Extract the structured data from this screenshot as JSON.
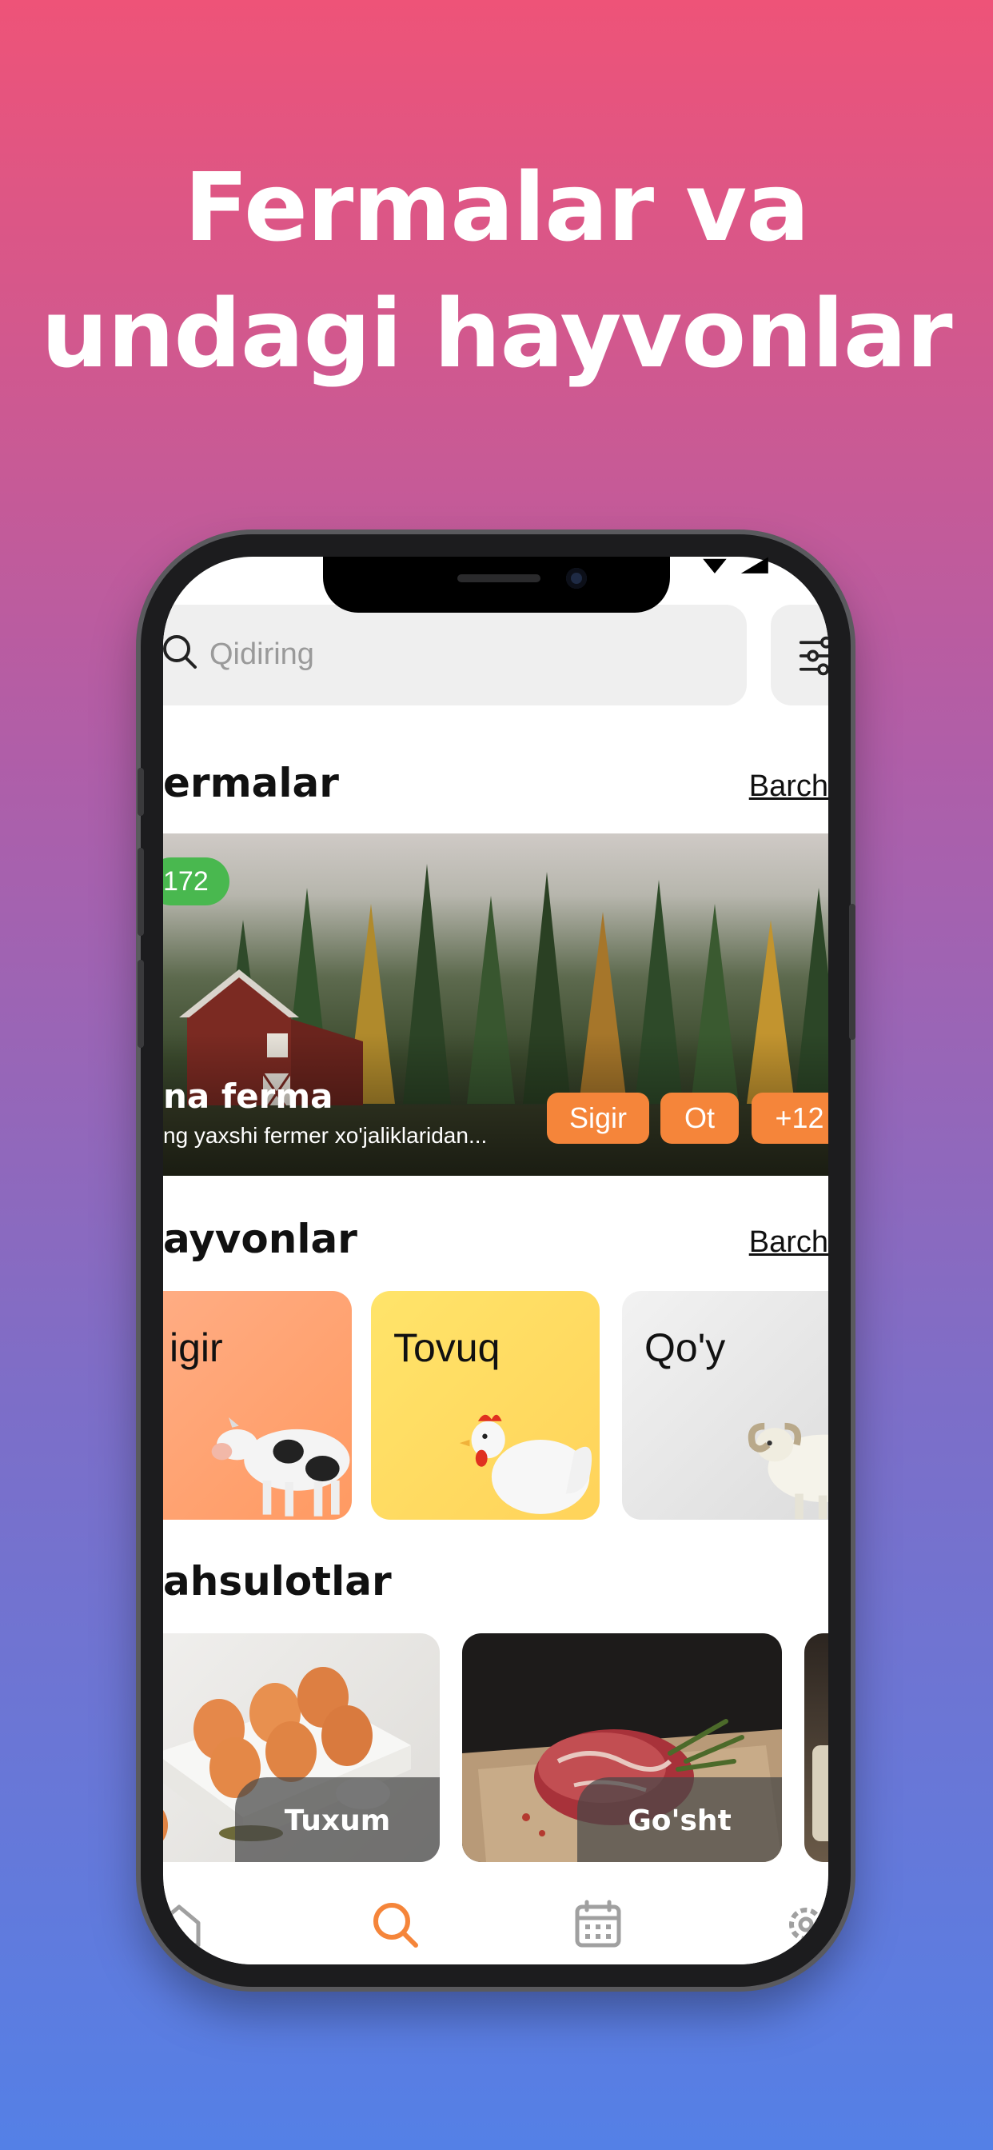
{
  "headline": {
    "line1": "Fermalar va",
    "line2": "undagi hayvonlar"
  },
  "colors": {
    "accent": "#f5853a",
    "badge": "#49b84f",
    "background_top": "#ee5378",
    "background_bottom": "#5480e6"
  },
  "search": {
    "placeholder": "Qidiring"
  },
  "sections": {
    "farms": {
      "title": "ermalar",
      "see_all": "Barch"
    },
    "animals": {
      "title": "ayvonlar",
      "see_all": "Barch"
    },
    "products": {
      "title": "ahsulotlar"
    }
  },
  "farm_card": {
    "badge": "172",
    "name": "na ferma",
    "description": "ng yaxshi fermer xo'jaliklaridan...",
    "tags": [
      "Sigir",
      "Ot",
      "+12"
    ]
  },
  "animals": [
    {
      "label": "igir",
      "icon": "cow-icon"
    },
    {
      "label": "Tovuq",
      "icon": "rooster-icon"
    },
    {
      "label": "Qo'y",
      "icon": "sheep-icon"
    }
  ],
  "products": [
    {
      "label": "Tuxum",
      "icon": "eggs-icon"
    },
    {
      "label": "Go'sht",
      "icon": "meat-icon"
    }
  ],
  "tab_bar": {
    "items": [
      {
        "icon": "home-icon",
        "active": false
      },
      {
        "icon": "search-icon",
        "active": true
      },
      {
        "icon": "calendar-icon",
        "active": false
      },
      {
        "icon": "gear-icon",
        "active": false
      }
    ]
  }
}
